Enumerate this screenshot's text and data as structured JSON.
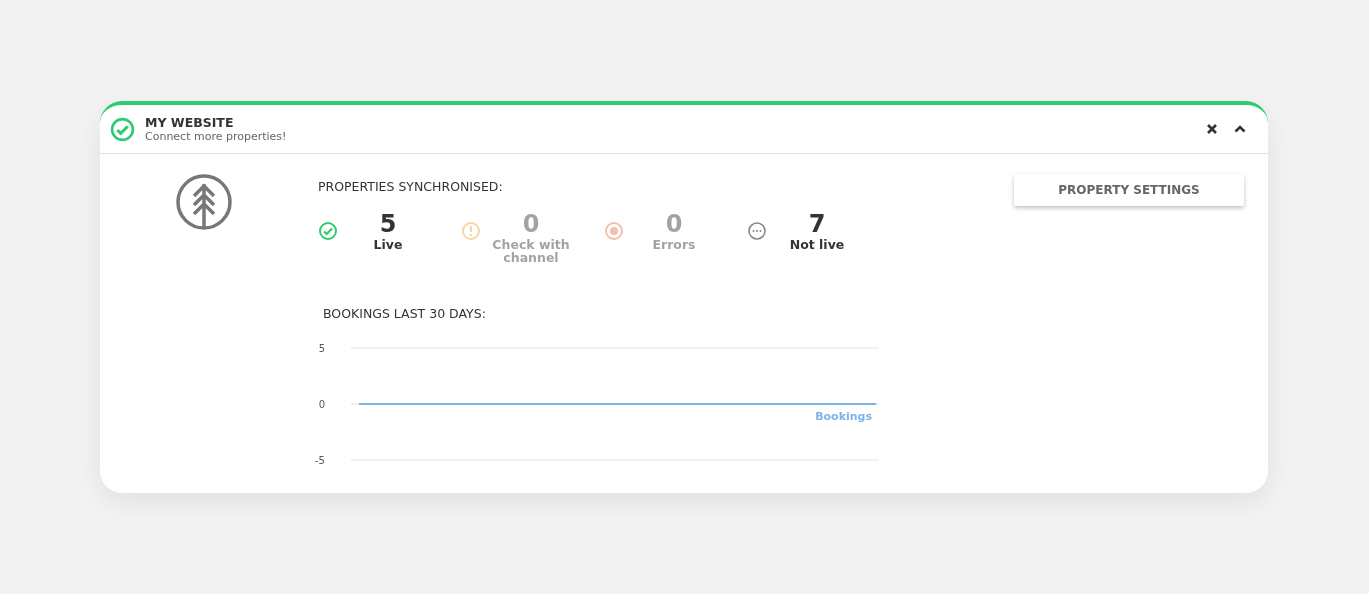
{
  "header": {
    "title": "MY WEBSITE",
    "subtitle": "Connect more properties!"
  },
  "sync": {
    "heading": "PROPERTIES SYNCHRONISED:",
    "stats": [
      {
        "kind": "live",
        "count": "5",
        "label": "Live",
        "dimmed": false
      },
      {
        "kind": "warning",
        "count": "0",
        "label": "Check with channel",
        "dimmed": true
      },
      {
        "kind": "error",
        "count": "0",
        "label": "Errors",
        "dimmed": true
      },
      {
        "kind": "notlive",
        "count": "7",
        "label": "Not live",
        "dimmed": false
      }
    ]
  },
  "bookings": {
    "heading": "BOOKINGS LAST 30 DAYS:",
    "chart_data": {
      "type": "line",
      "ylim": [
        -5,
        5
      ],
      "yticks": [
        5,
        0,
        -5
      ],
      "series": [
        {
          "name": "Bookings",
          "color": "#7cb5ec",
          "values": [
            0,
            0,
            0,
            0,
            0,
            0,
            0,
            0,
            0,
            0,
            0,
            0,
            0,
            0,
            0,
            0,
            0,
            0,
            0,
            0,
            0,
            0,
            0,
            0,
            0,
            0,
            0,
            0,
            0,
            0
          ]
        }
      ]
    }
  },
  "settings_button": "PROPERTY SETTINGS"
}
